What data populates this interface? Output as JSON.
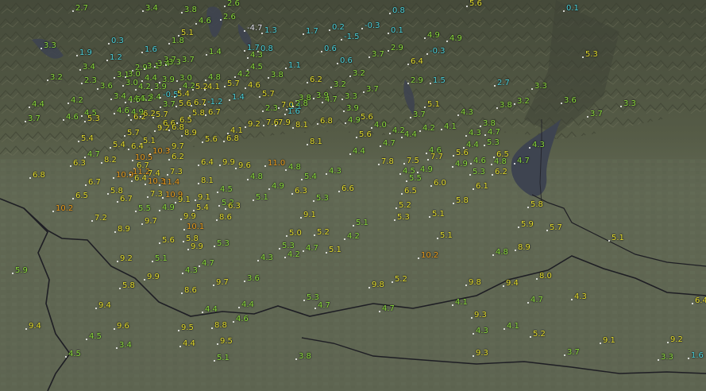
{
  "map": {
    "colors": {
      "cyan": "#4fd6e0",
      "green": "#8fe040",
      "yellow": "#e8e030",
      "orange": "#f0a020",
      "white": "#e8e8f0",
      "lake": "#3e4450",
      "border": "#1e1e24"
    },
    "stations": [
      {
        "t": "2.7",
        "c": "green"
      },
      {
        "t": "3.4",
        "c": "green"
      },
      {
        "t": "3.8",
        "c": "green"
      },
      {
        "t": "2.6",
        "c": "green"
      },
      {
        "t": "2.6",
        "c": "green"
      },
      {
        "t": "0.8",
        "c": "cyan"
      },
      {
        "t": "5.6",
        "c": "yellow"
      },
      {
        "t": "0.1",
        "c": "cyan"
      },
      {
        "t": "4.6",
        "c": "green"
      },
      {
        "t": "5.1",
        "c": "yellow"
      },
      {
        "t": "1.8",
        "c": "green"
      },
      {
        "t": "-4.7",
        "c": "white"
      },
      {
        "t": "1.3",
        "c": "cyan"
      },
      {
        "t": "1.7",
        "c": "cyan"
      },
      {
        "t": "0.2",
        "c": "cyan"
      },
      {
        "t": "-1.5",
        "c": "cyan"
      },
      {
        "t": "-0.3",
        "c": "cyan"
      },
      {
        "t": "0.1",
        "c": "cyan"
      },
      {
        "t": "4.9",
        "c": "green"
      },
      {
        "t": "4.9",
        "c": "green"
      },
      {
        "t": "3.3",
        "c": "green"
      },
      {
        "t": "0.3",
        "c": "cyan"
      },
      {
        "t": "1.6",
        "c": "cyan"
      },
      {
        "t": "1.7",
        "c": "cyan"
      },
      {
        "t": "0.8",
        "c": "cyan"
      },
      {
        "t": "0.6",
        "c": "cyan"
      },
      {
        "t": "2.9",
        "c": "green"
      },
      {
        "t": "-0.3",
        "c": "cyan"
      },
      {
        "t": "5.3",
        "c": "yellow"
      },
      {
        "t": "1.9",
        "c": "cyan"
      },
      {
        "t": "1.2",
        "c": "cyan"
      },
      {
        "t": "3.7",
        "c": "green"
      },
      {
        "t": "3.7",
        "c": "green"
      },
      {
        "t": "1.4",
        "c": "green"
      },
      {
        "t": "4.3",
        "c": "green"
      },
      {
        "t": "3.7",
        "c": "green"
      },
      {
        "t": "0.6",
        "c": "cyan"
      },
      {
        "t": "6.4",
        "c": "yellow"
      },
      {
        "t": "3.4",
        "c": "green"
      },
      {
        "t": "2.9",
        "c": "green"
      },
      {
        "t": "3.1",
        "c": "green"
      },
      {
        "t": "3.4",
        "c": "green"
      },
      {
        "t": "3.3",
        "c": "green"
      },
      {
        "t": "4.5",
        "c": "green"
      },
      {
        "t": "1.1",
        "c": "cyan"
      },
      {
        "t": "3.2",
        "c": "green"
      },
      {
        "t": "3.2",
        "c": "green"
      },
      {
        "t": "2.3",
        "c": "green"
      },
      {
        "t": "3.6",
        "c": "green"
      },
      {
        "t": "3.1",
        "c": "green"
      },
      {
        "t": "3.0",
        "c": "green"
      },
      {
        "t": "4.4",
        "c": "green"
      },
      {
        "t": "3.9",
        "c": "green"
      },
      {
        "t": "3.0",
        "c": "green"
      },
      {
        "t": "4.8",
        "c": "green"
      },
      {
        "t": "4.2",
        "c": "green"
      },
      {
        "t": "3.8",
        "c": "green"
      },
      {
        "t": "6.2",
        "c": "yellow"
      },
      {
        "t": "2.9",
        "c": "green"
      },
      {
        "t": "1.5",
        "c": "cyan"
      },
      {
        "t": "2.7",
        "c": "cyan"
      },
      {
        "t": "3.3",
        "c": "green"
      },
      {
        "t": "3.0",
        "c": "green"
      },
      {
        "t": "4.2",
        "c": "green"
      },
      {
        "t": "3.9",
        "c": "green"
      },
      {
        "t": "4.2",
        "c": "green"
      },
      {
        "t": "5.2",
        "c": "yellow"
      },
      {
        "t": "5.7",
        "c": "yellow"
      },
      {
        "t": "4.6",
        "c": "yellow"
      },
      {
        "t": "3.2",
        "c": "green"
      },
      {
        "t": "3.7",
        "c": "green"
      },
      {
        "t": "3.4",
        "c": "green"
      },
      {
        "t": "4.5",
        "c": "green"
      },
      {
        "t": "3.4",
        "c": "green"
      },
      {
        "t": "-0.5",
        "c": "cyan"
      },
      {
        "t": "5.4",
        "c": "yellow"
      },
      {
        "t": "4.1",
        "c": "yellow"
      },
      {
        "t": "5.7",
        "c": "yellow"
      },
      {
        "t": "3.8",
        "c": "green"
      },
      {
        "t": "3.9",
        "c": "green"
      },
      {
        "t": "3.3",
        "c": "green"
      },
      {
        "t": "4.4",
        "c": "green"
      },
      {
        "t": "4.2",
        "c": "green"
      },
      {
        "t": "4.2",
        "c": "green"
      },
      {
        "t": "4.6",
        "c": "green"
      },
      {
        "t": "3.7",
        "c": "green"
      },
      {
        "t": "5.6",
        "c": "yellow"
      },
      {
        "t": "6.7",
        "c": "yellow"
      },
      {
        "t": "-1.2",
        "c": "cyan"
      },
      {
        "t": "1.4",
        "c": "cyan"
      },
      {
        "t": "1.1",
        "c": "cyan"
      },
      {
        "t": "4.7",
        "c": "green"
      },
      {
        "t": "5.1",
        "c": "yellow"
      },
      {
        "t": "3.8",
        "c": "green"
      },
      {
        "t": "3.2",
        "c": "green"
      },
      {
        "t": "3.6",
        "c": "green"
      },
      {
        "t": "3.3",
        "c": "green"
      },
      {
        "t": "3.7",
        "c": "green"
      },
      {
        "t": "4.5",
        "c": "green"
      },
      {
        "t": "4.6",
        "c": "green"
      },
      {
        "t": "4.9",
        "c": "green"
      },
      {
        "t": "6.2",
        "c": "yellow"
      },
      {
        "t": "5.7",
        "c": "yellow"
      },
      {
        "t": "5.8",
        "c": "yellow"
      },
      {
        "t": "6.7",
        "c": "yellow"
      },
      {
        "t": "2.3",
        "c": "green"
      },
      {
        "t": "7.0",
        "c": "yellow"
      },
      {
        "t": "2.8",
        "c": "green"
      },
      {
        "t": "1.6",
        "c": "cyan"
      },
      {
        "t": "3.9",
        "c": "green"
      },
      {
        "t": "3.7",
        "c": "green"
      },
      {
        "t": "4.3",
        "c": "green"
      },
      {
        "t": "3.7",
        "c": "green"
      },
      {
        "t": "4.6",
        "c": "green"
      },
      {
        "t": "5.3",
        "c": "yellow"
      },
      {
        "t": "6.2",
        "c": "yellow"
      },
      {
        "t": "6.6",
        "c": "yellow"
      },
      {
        "t": "6.5",
        "c": "yellow"
      },
      {
        "t": "9.2",
        "c": "yellow"
      },
      {
        "t": "7.6",
        "c": "yellow"
      },
      {
        "t": "7.9",
        "c": "yellow"
      },
      {
        "t": "8.1",
        "c": "yellow"
      },
      {
        "t": "5.6",
        "c": "yellow"
      },
      {
        "t": "6.8",
        "c": "yellow"
      },
      {
        "t": "4.9",
        "c": "green"
      },
      {
        "t": "4.0",
        "c": "green"
      },
      {
        "t": "4.2",
        "c": "green"
      },
      {
        "t": "4.1",
        "c": "green"
      },
      {
        "t": "3.8",
        "c": "green"
      },
      {
        "t": "5.4",
        "c": "yellow"
      },
      {
        "t": "5.7",
        "c": "yellow"
      },
      {
        "t": "9.2",
        "c": "yellow"
      },
      {
        "t": "6.8",
        "c": "yellow"
      },
      {
        "t": "8.9",
        "c": "yellow"
      },
      {
        "t": "4.1",
        "c": "yellow"
      },
      {
        "t": "5.6",
        "c": "yellow"
      },
      {
        "t": "4.2",
        "c": "green"
      },
      {
        "t": "4.4",
        "c": "green"
      },
      {
        "t": "4.3",
        "c": "green"
      },
      {
        "t": "4.7",
        "c": "green"
      },
      {
        "t": "5.4",
        "c": "yellow"
      },
      {
        "t": "5.1",
        "c": "yellow"
      },
      {
        "t": "6.4",
        "c": "yellow"
      },
      {
        "t": "9.7",
        "c": "yellow"
      },
      {
        "t": "5.6",
        "c": "yellow"
      },
      {
        "t": "6.8",
        "c": "yellow"
      },
      {
        "t": "8.1",
        "c": "yellow"
      },
      {
        "t": "4.7",
        "c": "green"
      },
      {
        "t": "5.3",
        "c": "green"
      },
      {
        "t": "4.4",
        "c": "green"
      },
      {
        "t": "4.3",
        "c": "green"
      },
      {
        "t": "4.7",
        "c": "green"
      },
      {
        "t": "8.2",
        "c": "yellow"
      },
      {
        "t": "10.5",
        "c": "orange"
      },
      {
        "t": "10.3",
        "c": "orange"
      },
      {
        "t": "6.2",
        "c": "yellow"
      },
      {
        "t": "4.4",
        "c": "green"
      },
      {
        "t": "4.6",
        "c": "green"
      },
      {
        "t": "5.6",
        "c": "yellow"
      },
      {
        "t": "6.5",
        "c": "yellow"
      },
      {
        "t": "6.3",
        "c": "yellow"
      },
      {
        "t": "6.7",
        "c": "yellow"
      },
      {
        "t": "6.4",
        "c": "yellow"
      },
      {
        "t": "9.9",
        "c": "yellow"
      },
      {
        "t": "9.6",
        "c": "yellow"
      },
      {
        "t": "11.0",
        "c": "orange"
      },
      {
        "t": "4.8",
        "c": "green"
      },
      {
        "t": "7.8",
        "c": "yellow"
      },
      {
        "t": "7.5",
        "c": "yellow"
      },
      {
        "t": "7.7",
        "c": "yellow"
      },
      {
        "t": "4.9",
        "c": "green"
      },
      {
        "t": "4.6",
        "c": "green"
      },
      {
        "t": "4.8",
        "c": "green"
      },
      {
        "t": "4.7",
        "c": "green"
      },
      {
        "t": "6.8",
        "c": "yellow"
      },
      {
        "t": "10.9",
        "c": "orange"
      },
      {
        "t": "11.2",
        "c": "orange"
      },
      {
        "t": "7.4",
        "c": "yellow"
      },
      {
        "t": "7.3",
        "c": "yellow"
      },
      {
        "t": "4.3",
        "c": "green"
      },
      {
        "t": "4.5",
        "c": "green"
      },
      {
        "t": "4.9",
        "c": "green"
      },
      {
        "t": "5.3",
        "c": "green"
      },
      {
        "t": "6.2",
        "c": "yellow"
      },
      {
        "t": "6.7",
        "c": "yellow"
      },
      {
        "t": "6.4",
        "c": "yellow"
      },
      {
        "t": "10.3",
        "c": "orange"
      },
      {
        "t": "11.4",
        "c": "orange"
      },
      {
        "t": "8.1",
        "c": "yellow"
      },
      {
        "t": "4.8",
        "c": "green"
      },
      {
        "t": "5.4",
        "c": "green"
      },
      {
        "t": "5.5",
        "c": "green"
      },
      {
        "t": "6.0",
        "c": "yellow"
      },
      {
        "t": "6.1",
        "c": "yellow"
      },
      {
        "t": "5.8",
        "c": "yellow"
      },
      {
        "t": "7.3",
        "c": "yellow"
      },
      {
        "t": "10.9",
        "c": "orange"
      },
      {
        "t": "4.5",
        "c": "green"
      },
      {
        "t": "4.9",
        "c": "green"
      },
      {
        "t": "6.3",
        "c": "yellow"
      },
      {
        "t": "6.6",
        "c": "yellow"
      },
      {
        "t": "6.5",
        "c": "yellow"
      },
      {
        "t": "6.5",
        "c": "yellow"
      },
      {
        "t": "6.7",
        "c": "yellow"
      },
      {
        "t": "9.1",
        "c": "yellow"
      },
      {
        "t": "9.1",
        "c": "yellow"
      },
      {
        "t": "5.2",
        "c": "green"
      },
      {
        "t": "5.1",
        "c": "green"
      },
      {
        "t": "5.3",
        "c": "green"
      },
      {
        "t": "5.8",
        "c": "yellow"
      },
      {
        "t": "5.8",
        "c": "yellow"
      },
      {
        "t": "10.2",
        "c": "orange"
      },
      {
        "t": "5.5",
        "c": "green"
      },
      {
        "t": "4.9",
        "c": "green"
      },
      {
        "t": "5.4",
        "c": "yellow"
      },
      {
        "t": "6.3",
        "c": "yellow"
      },
      {
        "t": "5.2",
        "c": "yellow"
      },
      {
        "t": "7.2",
        "c": "yellow"
      },
      {
        "t": "9.7",
        "c": "yellow"
      },
      {
        "t": "9.9",
        "c": "yellow"
      },
      {
        "t": "8.6",
        "c": "yellow"
      },
      {
        "t": "9.1",
        "c": "yellow"
      },
      {
        "t": "5.1",
        "c": "green"
      },
      {
        "t": "5.3",
        "c": "yellow"
      },
      {
        "t": "5.1",
        "c": "yellow"
      },
      {
        "t": "5.9",
        "c": "yellow"
      },
      {
        "t": "5.7",
        "c": "yellow"
      },
      {
        "t": "8.9",
        "c": "yellow"
      },
      {
        "t": "10.1",
        "c": "orange"
      },
      {
        "t": "5.0",
        "c": "yellow"
      },
      {
        "t": "5.2",
        "c": "yellow"
      },
      {
        "t": "4.2",
        "c": "green"
      },
      {
        "t": "5.1",
        "c": "yellow"
      },
      {
        "t": "5.1",
        "c": "yellow"
      },
      {
        "t": "5.6",
        "c": "yellow"
      },
      {
        "t": "5.8",
        "c": "yellow"
      },
      {
        "t": "9.9",
        "c": "yellow"
      },
      {
        "t": "5.3",
        "c": "green"
      },
      {
        "t": "5.3",
        "c": "green"
      },
      {
        "t": "4.7",
        "c": "green"
      },
      {
        "t": "5.1",
        "c": "yellow"
      },
      {
        "t": "8.9",
        "c": "yellow"
      },
      {
        "t": "9.2",
        "c": "yellow"
      },
      {
        "t": "5.1",
        "c": "green"
      },
      {
        "t": "4.3",
        "c": "green"
      },
      {
        "t": "4.2",
        "c": "green"
      },
      {
        "t": "10.2",
        "c": "orange"
      },
      {
        "t": "4.8",
        "c": "green"
      },
      {
        "t": "5.9",
        "c": "green"
      },
      {
        "t": "4.7",
        "c": "green"
      },
      {
        "t": "4.3",
        "c": "green"
      },
      {
        "t": "8.0",
        "c": "yellow"
      },
      {
        "t": "5.8",
        "c": "yellow"
      },
      {
        "t": "9.9",
        "c": "yellow"
      },
      {
        "t": "9.7",
        "c": "yellow"
      },
      {
        "t": "3.6",
        "c": "green"
      },
      {
        "t": "5.2",
        "c": "yellow"
      },
      {
        "t": "9.8",
        "c": "yellow"
      },
      {
        "t": "9.8",
        "c": "yellow"
      },
      {
        "t": "9.4",
        "c": "yellow"
      },
      {
        "t": "8.6",
        "c": "yellow"
      },
      {
        "t": "5.3",
        "c": "green"
      },
      {
        "t": "4.1",
        "c": "green"
      },
      {
        "t": "4.7",
        "c": "green"
      },
      {
        "t": "4.3",
        "c": "yellow"
      },
      {
        "t": "6.4",
        "c": "yellow"
      },
      {
        "t": "9.4",
        "c": "yellow"
      },
      {
        "t": "4.4",
        "c": "green"
      },
      {
        "t": "4.4",
        "c": "green"
      },
      {
        "t": "4.7",
        "c": "green"
      },
      {
        "t": "4.7",
        "c": "green"
      },
      {
        "t": "9.3",
        "c": "yellow"
      },
      {
        "t": "9.4",
        "c": "yellow"
      },
      {
        "t": "9.6",
        "c": "yellow"
      },
      {
        "t": "9.5",
        "c": "yellow"
      },
      {
        "t": "8.8",
        "c": "yellow"
      },
      {
        "t": "4.6",
        "c": "green"
      },
      {
        "t": "4.3",
        "c": "green"
      },
      {
        "t": "4.1",
        "c": "green"
      },
      {
        "t": "5.2",
        "c": "yellow"
      },
      {
        "t": "9.1",
        "c": "yellow"
      },
      {
        "t": "9.2",
        "c": "yellow"
      },
      {
        "t": "4.5",
        "c": "green"
      },
      {
        "t": "3.4",
        "c": "green"
      },
      {
        "t": "4.4",
        "c": "yellow"
      },
      {
        "t": "9.5",
        "c": "yellow"
      },
      {
        "t": "9.3",
        "c": "yellow"
      },
      {
        "t": "3.7",
        "c": "green"
      },
      {
        "t": "4.5",
        "c": "green"
      },
      {
        "t": "5.1",
        "c": "green"
      },
      {
        "t": "3.8",
        "c": "green"
      },
      {
        "t": "3.3",
        "c": "green"
      },
      {
        "t": "1.6",
        "c": "cyan"
      }
    ]
  }
}
